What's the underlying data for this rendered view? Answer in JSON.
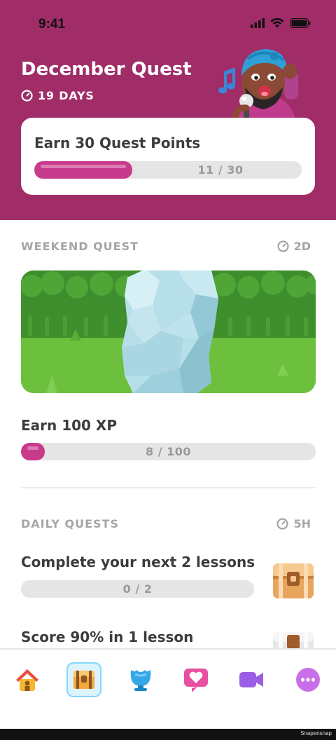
{
  "status": {
    "time": "9:41"
  },
  "header": {
    "title": "December Quest",
    "days_left": "19 DAYS",
    "color": "#a02d68"
  },
  "monthly": {
    "label": "Earn 30 Quest Points",
    "progress": {
      "current": 11,
      "total": 30,
      "text": "11 / 30"
    },
    "fill_color": "#c83a8c"
  },
  "weekend": {
    "title": "WEEKEND QUEST",
    "time_left": "2D",
    "task": "Earn 100 XP",
    "progress": {
      "current": 8,
      "total": 100,
      "text": "8 / 100"
    }
  },
  "daily": {
    "title": "DAILY QUESTS",
    "time_left": "5H",
    "quests": [
      {
        "label": "Complete your next 2 lessons",
        "progress": {
          "current": 0,
          "total": 2,
          "text": "0 / 2"
        },
        "reward_icon": "chest-icon"
      },
      {
        "label": "Score 90% in 1 lesson",
        "reward_icon": "chest-icon"
      }
    ]
  },
  "tabs": [
    {
      "name": "home",
      "icon": "house-icon",
      "active": false
    },
    {
      "name": "quests",
      "icon": "chest-icon",
      "active": true
    },
    {
      "name": "leagues",
      "icon": "trophy-icon",
      "active": false
    },
    {
      "name": "health",
      "icon": "heart-icon",
      "active": false
    },
    {
      "name": "video",
      "icon": "video-camera-icon",
      "active": false
    },
    {
      "name": "more",
      "icon": "more-dots-icon",
      "active": false
    }
  ],
  "watermark": "Snapensnap"
}
